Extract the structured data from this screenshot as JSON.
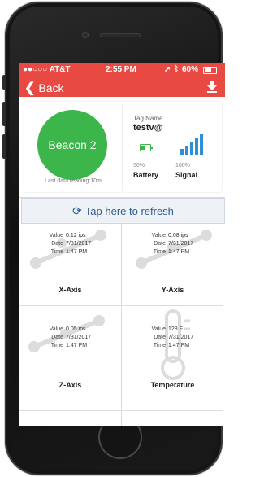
{
  "status": {
    "carrier": "●●○○○ AT&T",
    "time": "2:55 PM",
    "battery": "60%"
  },
  "nav": {
    "back_label": "Back",
    "download_icon": "download-icon"
  },
  "beacon": {
    "name": "Beacon 2",
    "last_reading": "Last data reading:10m",
    "color": "#3cb54a"
  },
  "tag": {
    "label": "Tag Name",
    "value": "testv@"
  },
  "battery": {
    "percent": "50%",
    "label": "Battery",
    "level": 0.5
  },
  "signal": {
    "percent": "100%",
    "label": "Signal",
    "level": 1.0
  },
  "refresh": {
    "label": "Tap here to refresh",
    "icon": "refresh-icon"
  },
  "sensors": [
    {
      "title": "X-Axis",
      "value": "0.12 ips",
      "date": "7/31/2017",
      "time": "1:47 PM"
    },
    {
      "title": "Y-Axis",
      "value": "0.08 ips",
      "date": "7/31/2017",
      "time": "1:47 PM"
    },
    {
      "title": "Z-Axis",
      "value": "0.05 ips",
      "date": "7/31/2017",
      "time": "1:47 PM"
    },
    {
      "title": "Temperature",
      "value": "128 F",
      "date": "7/31/2017",
      "time": "1:47 PM"
    }
  ],
  "labels": {
    "value": "Value",
    "date": "Date",
    "time": "Time"
  },
  "colors": {
    "accent": "#e84943",
    "refresh_text": "#2f5d8f",
    "signal": "#2e8fd6"
  }
}
